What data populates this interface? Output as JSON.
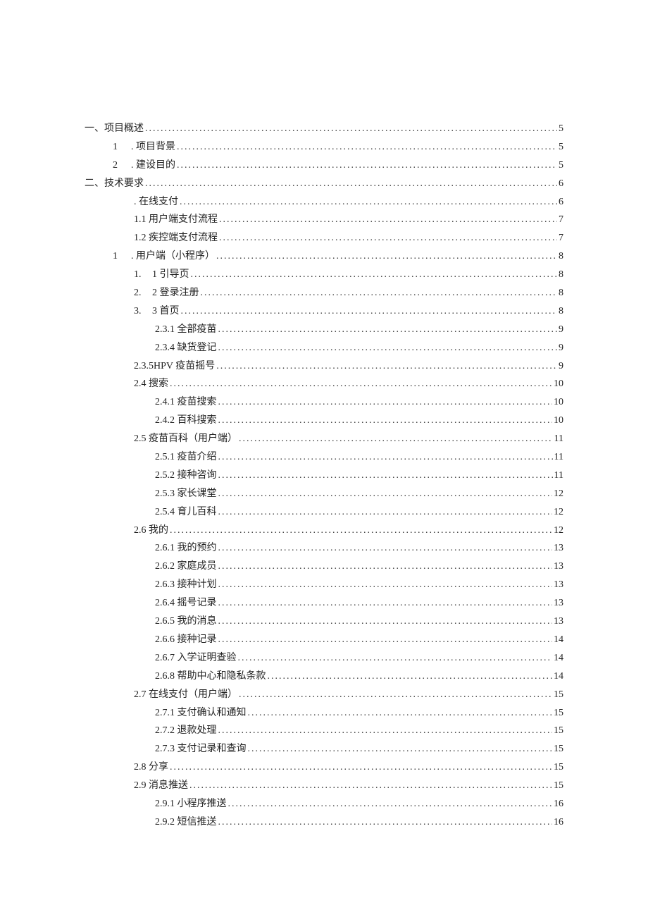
{
  "toc": [
    {
      "level": 0,
      "numPrefix": "",
      "text": "一、项目概述",
      "page": "5"
    },
    {
      "level": 1,
      "numPrefix": "1",
      "text": ". 项目背景",
      "page": "5"
    },
    {
      "level": 1,
      "numPrefix": "2",
      "text": ". 建设目的",
      "page": "5"
    },
    {
      "level": 0,
      "numPrefix": "",
      "text": "二、技术要求",
      "page": "6"
    },
    {
      "level": 2,
      "numPrefix": "",
      "text": ". 在线支付",
      "page": "6"
    },
    {
      "level": 3,
      "numPrefix": "",
      "text": "1.1 用户端支付流程",
      "page": "7"
    },
    {
      "level": 3,
      "numPrefix": "",
      "text": "1.2 疾控端支付流程",
      "page": "7"
    },
    {
      "level": 1,
      "numPrefix": "1",
      "text": ". 用户端（小程序）",
      "page": "8"
    },
    {
      "level": 2,
      "numPrefix": "1.",
      "text": "1 引导页",
      "page": "8"
    },
    {
      "level": 2,
      "numPrefix": "2.",
      "text": "2 登录注册",
      "page": "8"
    },
    {
      "level": 2,
      "numPrefix": "3.",
      "text": "3 首页",
      "page": "8"
    },
    {
      "level": 4,
      "numPrefix": "",
      "text": "2.3.1 全部疫苗",
      "page": "9"
    },
    {
      "level": 4,
      "numPrefix": "",
      "text": "2.3.4 缺货登记",
      "page": "9"
    },
    {
      "level": 3,
      "numPrefix": "",
      "text": "2.3.5HPV 疫苗摇号",
      "page": "9"
    },
    {
      "level": 3,
      "numPrefix": "",
      "text": "2.4 搜索",
      "page": "10"
    },
    {
      "level": 4,
      "numPrefix": "",
      "text": "2.4.1 疫苗搜索",
      "page": "10"
    },
    {
      "level": 4,
      "numPrefix": "",
      "text": "2.4.2 百科搜索",
      "page": "10"
    },
    {
      "level": 3,
      "numPrefix": "",
      "text": "2.5 疫苗百科（用户端）",
      "page": "11"
    },
    {
      "level": 4,
      "numPrefix": "",
      "text": "2.5.1 疫苗介绍",
      "page": "11"
    },
    {
      "level": 4,
      "numPrefix": "",
      "text": "2.5.2 接种咨询",
      "page": "11"
    },
    {
      "level": 4,
      "numPrefix": "",
      "text": "2.5.3 家长课堂",
      "page": "12"
    },
    {
      "level": 4,
      "numPrefix": "",
      "text": "2.5.4 育儿百科",
      "page": "12"
    },
    {
      "level": 3,
      "numPrefix": "",
      "text": "2.6 我的",
      "page": "12"
    },
    {
      "level": 4,
      "numPrefix": "",
      "text": "2.6.1 我的预约",
      "page": "13"
    },
    {
      "level": 4,
      "numPrefix": "",
      "text": "2.6.2 家庭成员",
      "page": "13"
    },
    {
      "level": 4,
      "numPrefix": "",
      "text": "2.6.3 接种计划",
      "page": "13"
    },
    {
      "level": 4,
      "numPrefix": "",
      "text": "2.6.4 摇号记录",
      "page": "13"
    },
    {
      "level": 4,
      "numPrefix": "",
      "text": "2.6.5 我的消息",
      "page": "13"
    },
    {
      "level": 4,
      "numPrefix": "",
      "text": "2.6.6 接种记录",
      "page": "14"
    },
    {
      "level": 4,
      "numPrefix": "",
      "text": "2.6.7 入学证明查验",
      "page": "14"
    },
    {
      "level": 4,
      "numPrefix": "",
      "text": "2.6.8 帮助中心和隐私条款",
      "page": "14"
    },
    {
      "level": 3,
      "numPrefix": "",
      "text": "2.7 在线支付（用户端）",
      "page": "15"
    },
    {
      "level": 4,
      "numPrefix": "",
      "text": "2.7.1 支付确认和通知",
      "page": "15"
    },
    {
      "level": 4,
      "numPrefix": "",
      "text": "2.7.2 退款处理",
      "page": "15"
    },
    {
      "level": 4,
      "numPrefix": "",
      "text": "2.7.3 支付记录和查询",
      "page": "15"
    },
    {
      "level": 3,
      "numPrefix": "",
      "text": "2.8 分享",
      "page": "15"
    },
    {
      "level": 3,
      "numPrefix": "",
      "text": "2.9 消息推送",
      "page": "15"
    },
    {
      "level": 4,
      "numPrefix": "",
      "text": "2.9.1 小程序推送",
      "page": "16"
    },
    {
      "level": 4,
      "numPrefix": "",
      "text": "2.9.2 短信推送",
      "page": "16"
    }
  ]
}
